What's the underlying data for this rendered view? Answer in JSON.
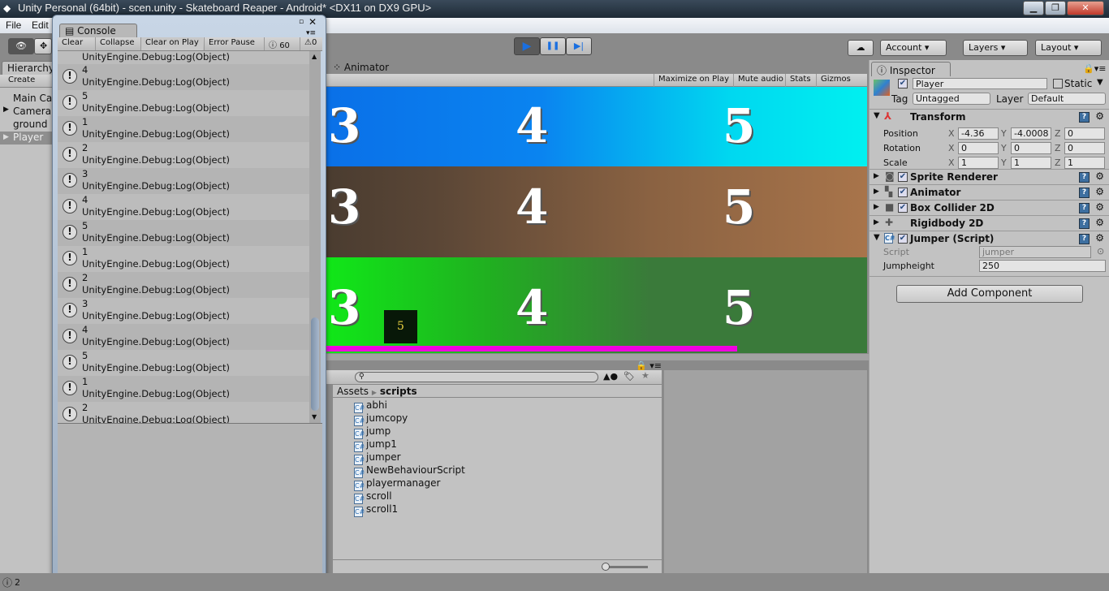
{
  "window": {
    "title": "Unity Personal (64bit) - scen.unity - Skateboard Reaper - Android* <DX11 on DX9 GPU>",
    "minimize": "▁",
    "maximize": "❐",
    "close": "✕"
  },
  "menu": [
    "File",
    "Edit"
  ],
  "toolbar": {
    "cloud": "☁",
    "account": "Account",
    "layers": "Layers",
    "layout": "Layout",
    "play": "▶",
    "pause": "❚❚",
    "step": "▶|"
  },
  "hierarchy": {
    "tab": "Hierarchy",
    "create": "Create",
    "items": [
      "Main Camera",
      "Camera",
      "ground",
      "Player"
    ],
    "selected": "Player"
  },
  "console": {
    "tab": "Console",
    "buttons": [
      "Clear",
      "Collapse",
      "Clear on Play",
      "Error Pause"
    ],
    "log_count": "60",
    "warn_count": "0",
    "partial": "UnityEngine.Debug:Log(Object)",
    "entries": [
      {
        "msg": "4",
        "trace": "UnityEngine.Debug:Log(Object)"
      },
      {
        "msg": "5",
        "trace": "UnityEngine.Debug:Log(Object)"
      },
      {
        "msg": "1",
        "trace": "UnityEngine.Debug:Log(Object)"
      },
      {
        "msg": "2",
        "trace": "UnityEngine.Debug:Log(Object)"
      },
      {
        "msg": "3",
        "trace": "UnityEngine.Debug:Log(Object)"
      },
      {
        "msg": "4",
        "trace": "UnityEngine.Debug:Log(Object)"
      },
      {
        "msg": "5",
        "trace": "UnityEngine.Debug:Log(Object)"
      },
      {
        "msg": "1",
        "trace": "UnityEngine.Debug:Log(Object)"
      },
      {
        "msg": "2",
        "trace": "UnityEngine.Debug:Log(Object)"
      },
      {
        "msg": "3",
        "trace": "UnityEngine.Debug:Log(Object)"
      },
      {
        "msg": "4",
        "trace": "UnityEngine.Debug:Log(Object)"
      },
      {
        "msg": "5",
        "trace": "UnityEngine.Debug:Log(Object)"
      },
      {
        "msg": "1",
        "trace": "UnityEngine.Debug:Log(Object)"
      },
      {
        "msg": "2",
        "trace": "UnityEngine.Debug:Log(Object)"
      }
    ]
  },
  "game": {
    "tab": "Animator",
    "buttons": [
      "Maximize on Play",
      "Mute audio",
      "Stats",
      "Gizmos"
    ],
    "rows": [
      [
        "3",
        "4",
        "5"
      ],
      [
        "3",
        "4",
        "5"
      ],
      [
        "3",
        "4",
        "5"
      ]
    ],
    "player_label": "5",
    "colors": {
      "blue": "#0a84f0",
      "cyan": "#00f0f0",
      "brown_dark": "#5a4636",
      "brown_light": "#a8744a",
      "green_bright": "#10e818",
      "green_dark": "#3a7a3a",
      "magenta": "#f000e0"
    }
  },
  "project": {
    "breadcrumb_root": "Assets",
    "breadcrumb_current": "scripts",
    "assets": [
      "abhi",
      "jumcopy",
      "jump",
      "jump1",
      "jumper",
      "NewBehaviourScript",
      "playermanager",
      "scroll",
      "scroll1"
    ]
  },
  "inspector": {
    "tab": "Inspector",
    "name": "Player",
    "static": "Static",
    "tag_label": "Tag",
    "tag": "Untagged",
    "layer_label": "Layer",
    "layer": "Default",
    "transform": {
      "title": "Transform",
      "rows": [
        {
          "label": "Position",
          "x": "-4.36",
          "y": "-4.0008",
          "z": "0"
        },
        {
          "label": "Rotation",
          "x": "0",
          "y": "0",
          "z": "0"
        },
        {
          "label": "Scale",
          "x": "1",
          "y": "1",
          "z": "1"
        }
      ]
    },
    "components": [
      "Sprite Renderer",
      "Animator",
      "Box Collider 2D",
      "Rigidbody 2D"
    ],
    "script": {
      "title": "Jumper (Script)",
      "script_label": "Script",
      "script_value": "jumper",
      "jump_label": "Jumpheight",
      "jump_value": "250"
    },
    "add_component": "Add Component"
  },
  "status": {
    "text": "2"
  }
}
